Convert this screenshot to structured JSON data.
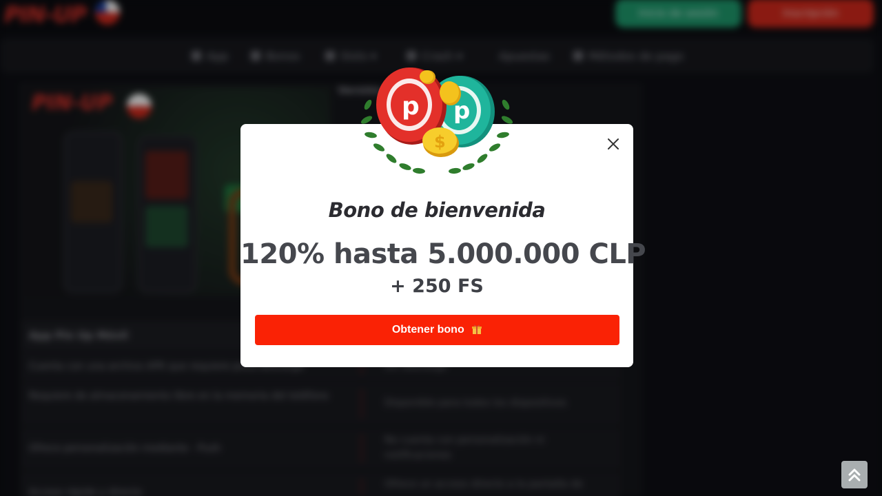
{
  "header": {
    "logo_text": "PIN-UP",
    "login_label": "Inicio de sesión",
    "register_label": "Inscripción"
  },
  "nav": {
    "items": [
      {
        "label": "App",
        "icon": "phone-icon"
      },
      {
        "label": "Bonos",
        "icon": "gift-icon"
      },
      {
        "label": "Slots",
        "icon": "slot-icon"
      },
      {
        "label": "Crash",
        "icon": "crash-icon"
      },
      {
        "label": "Apuestas",
        "icon": ""
      },
      {
        "label": "Métodos de pago",
        "icon": "card-icon"
      }
    ]
  },
  "content": {
    "promo_logo": "PIN-UP",
    "side_heading": "Versión",
    "table_title": "App Pin Up Móvil",
    "rows": [
      {
        "c1": "Cuenta con una archivo APK que requiere poca descarga",
        "c2": "Sin descarga"
      },
      {
        "c1": "Requiere de almacenamiento libre en la memoria del teléfono",
        "c2": "Disponible para todos los dispositivos"
      },
      {
        "c1": "Ofrece personalización mediante - Push",
        "c2": "No cuenta con personalización ni notificaciones"
      },
      {
        "c1": "Acceso rápido y directo",
        "c2": "Ofrece un acceso directo a la pantalla de"
      }
    ]
  },
  "modal": {
    "title": "Bono de bienvenida",
    "amount": "120% hasta 5.000.000 CLP",
    "free_spins": "+ 250 FS",
    "cta_label": "Obtener bono",
    "colors": {
      "cta": "#fa2205",
      "chip_red": "#e3302a",
      "chip_teal": "#1fb59c",
      "coin": "#f4c21d"
    }
  }
}
